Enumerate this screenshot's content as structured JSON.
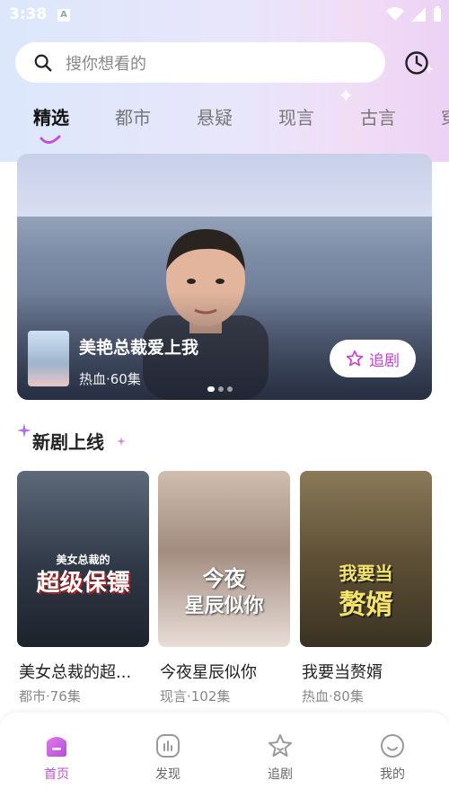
{
  "status_bar": {
    "time": "3:38",
    "notification_glyph": "A"
  },
  "search": {
    "placeholder": "搜你想看的"
  },
  "tabs": [
    {
      "label": "精选",
      "active": true
    },
    {
      "label": "都市",
      "active": false
    },
    {
      "label": "悬疑",
      "active": false
    },
    {
      "label": "现言",
      "active": false
    },
    {
      "label": "古言",
      "active": false
    },
    {
      "label": "穿",
      "active": false
    }
  ],
  "banner": {
    "title": "美艳总裁爱上我",
    "meta": "热血·60集",
    "follow_label": "追剧",
    "page_count": 3,
    "active_index": 0
  },
  "section": {
    "title": "新剧上线"
  },
  "cards": [
    {
      "title": "美女总裁的超...",
      "meta": "都市·76集",
      "cover_line1": "美女总裁的",
      "cover_line2": "超级保镖"
    },
    {
      "title": "今夜星辰似你",
      "meta": "现言·102集",
      "cover_line1": "今夜",
      "cover_line2": "星辰似你"
    },
    {
      "title": "我要当赘婿",
      "meta": "热血·80集",
      "cover_line1": "我要当",
      "cover_line2": "赘婿"
    }
  ],
  "bottom_nav": [
    {
      "label": "首页",
      "icon": "home-icon",
      "active": true
    },
    {
      "label": "发现",
      "icon": "discover-icon",
      "active": false
    },
    {
      "label": "追剧",
      "icon": "star-icon",
      "active": false
    },
    {
      "label": "我的",
      "icon": "profile-icon",
      "active": false
    }
  ],
  "colors": {
    "accent": "#c24fd6",
    "follow_text": "#c044c9"
  }
}
